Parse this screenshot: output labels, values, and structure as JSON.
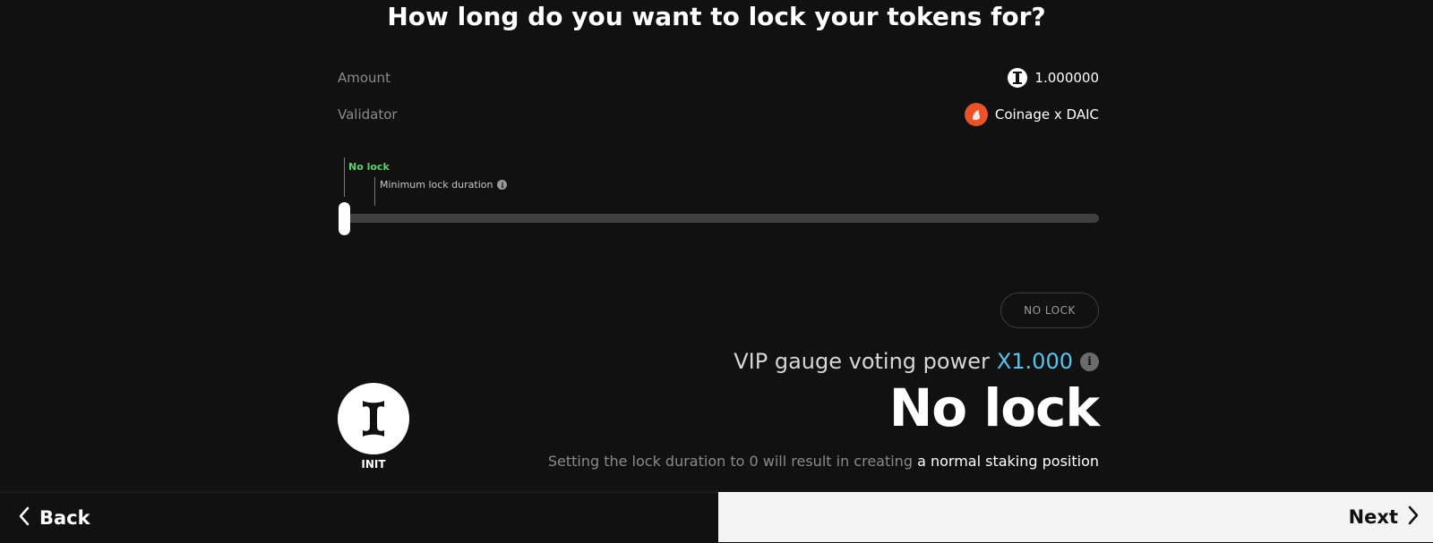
{
  "page": {
    "title": "How long do you want to lock your tokens for?"
  },
  "summary": {
    "amount_label": "Amount",
    "amount_value": "1.000000",
    "amount_icon": "init-token-icon",
    "validator_label": "Validator",
    "validator_value": "Coinage x DAIC",
    "validator_icon": "coinage-validator-icon"
  },
  "slider": {
    "start_label": "No lock",
    "min_label": "Minimum lock duration",
    "info_icon": "info-icon",
    "value_fraction": 0,
    "colors": {
      "start_label": "#5fd06a",
      "track": "#404040",
      "thumb": "#ffffff"
    }
  },
  "no_lock_button": {
    "label": "NO LOCK"
  },
  "vip": {
    "label": "VIP gauge voting power",
    "value": "X1.000",
    "value_color": "#5bc2ee"
  },
  "token": {
    "name": "INIT",
    "icon": "init-logo-icon"
  },
  "lock_display": {
    "text": "No lock"
  },
  "hint": {
    "prefix": "Setting the lock duration to 0 will result in creating",
    "emphasis": "a normal staking position"
  },
  "footer": {
    "back_label": "Back",
    "next_label": "Next"
  }
}
